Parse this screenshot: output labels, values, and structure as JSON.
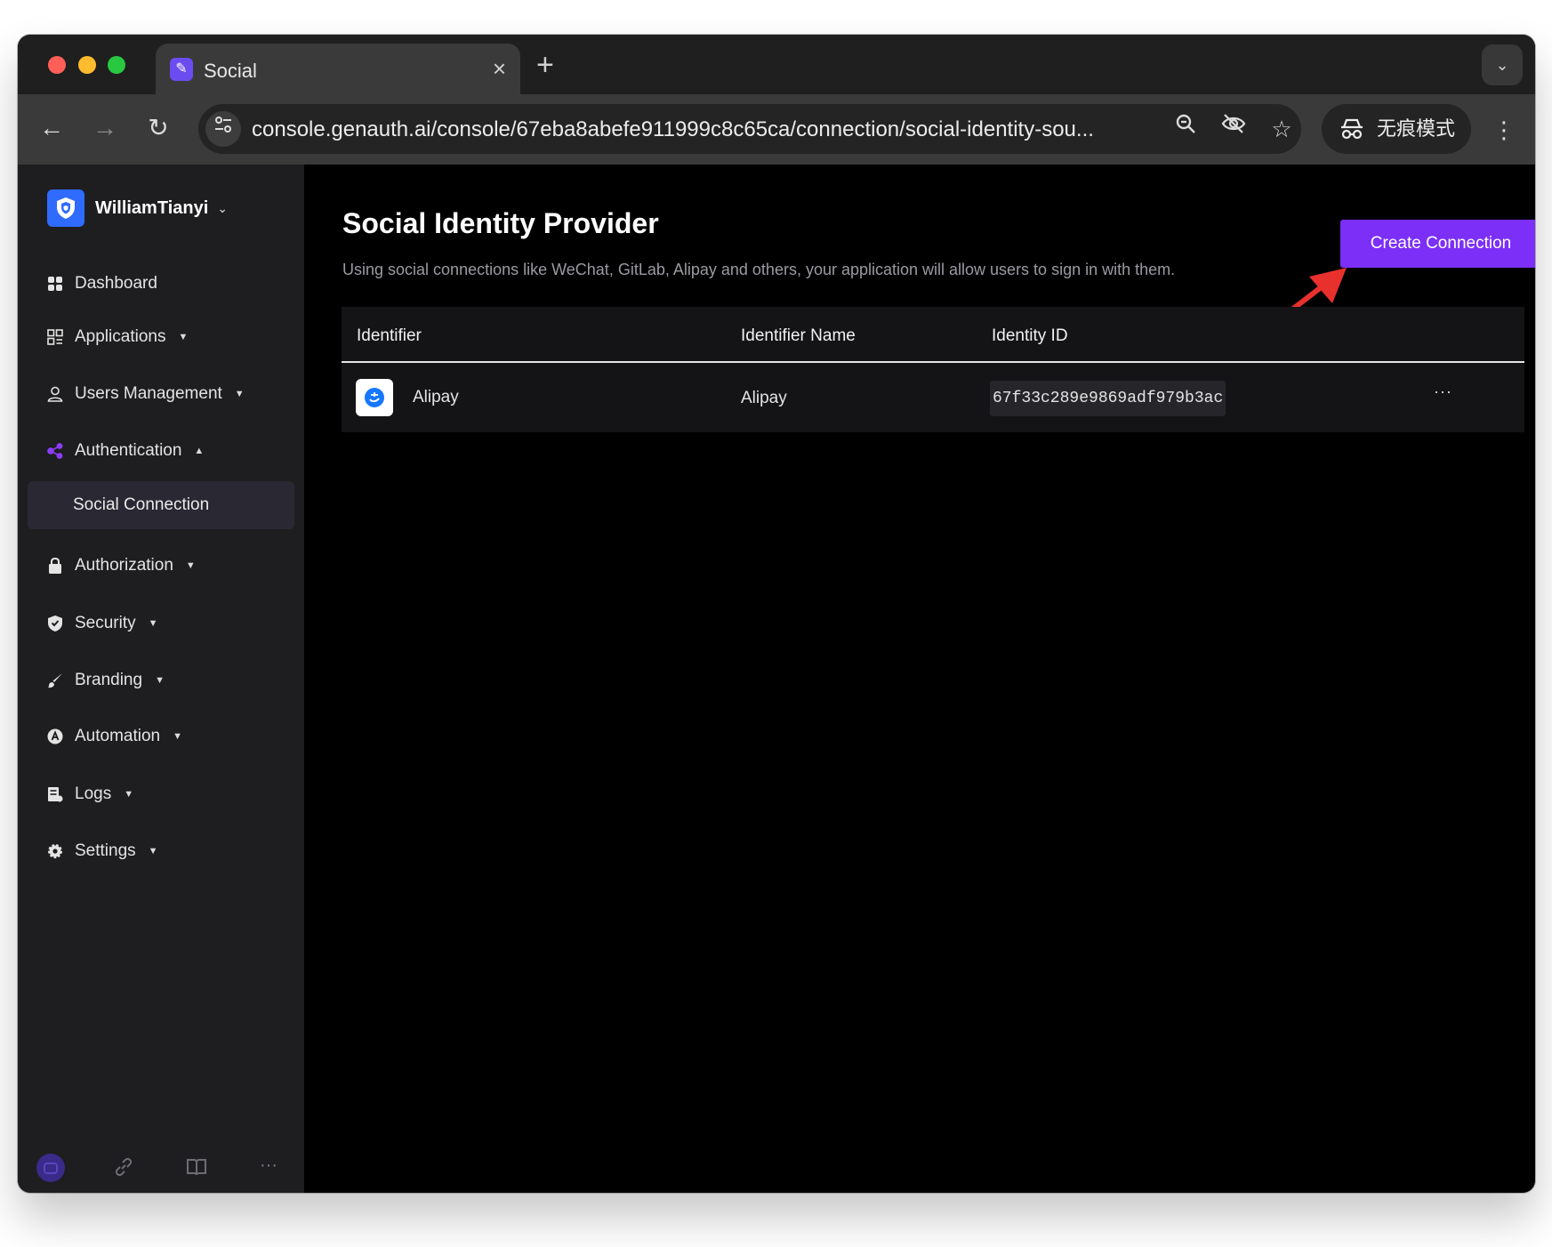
{
  "browser": {
    "tab": {
      "title": "Social"
    },
    "url": "console.genauth.ai/console/67eba8abefe911999c8c65ca/connection/social-identity-sou...",
    "incognito_label": "无痕模式"
  },
  "sidebar": {
    "org_name": "WilliamTianyi",
    "items": [
      {
        "label": "Dashboard"
      },
      {
        "label": "Applications"
      },
      {
        "label": "Users Management"
      },
      {
        "label": "Authentication"
      },
      {
        "label": "Social Connection"
      },
      {
        "label": "Authorization"
      },
      {
        "label": "Security"
      },
      {
        "label": "Branding"
      },
      {
        "label": "Automation"
      },
      {
        "label": "Logs"
      },
      {
        "label": "Settings"
      }
    ]
  },
  "main": {
    "title": "Social Identity Provider",
    "description": "Using social connections like WeChat, GitLab, Alipay and others, your application will allow users to sign in with them.",
    "create_button": "Create Connection",
    "table": {
      "columns": [
        "Identifier",
        "Identifier Name",
        "Identity ID"
      ],
      "rows": [
        {
          "identifier": "Alipay",
          "identifier_name": "Alipay",
          "identity_id": "67f33c289e9869adf979b3ac"
        }
      ]
    }
  },
  "colors": {
    "accent": "#7b2ff7",
    "annotation_arrow": "#e8312d",
    "org_badge": "#2f6bff"
  }
}
